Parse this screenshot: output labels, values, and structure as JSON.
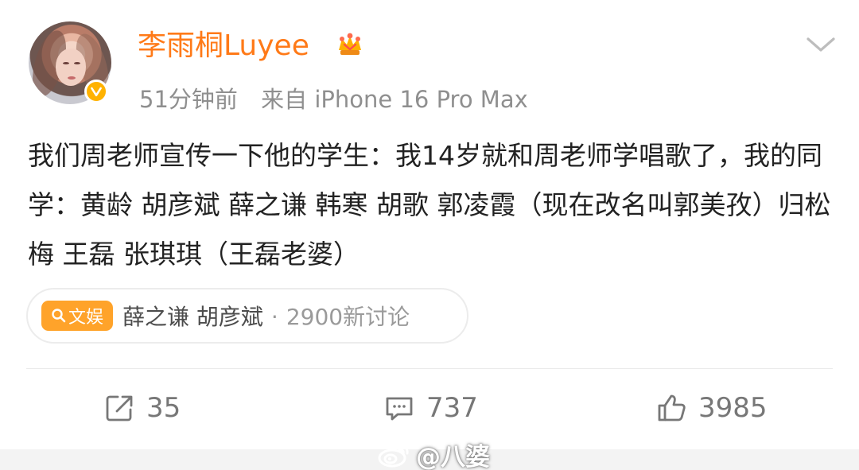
{
  "post": {
    "username": "李雨桐Luyee",
    "time": "51分钟前",
    "source": "来自 iPhone 16 Pro Max",
    "content": "我们周老师宣传一下他的学生：我14岁就和周老师学唱歌了，我的同学：黄龄 胡彦斌 薛之谦 韩寒 胡歌 郭凌霞（现在改名叫郭美孜）归松梅 王磊 张琪琪（王磊老婆）"
  },
  "topic": {
    "tag": "文娱",
    "text": "薛之谦 胡彦斌",
    "separator": "·",
    "count": "2900新讨论"
  },
  "actions": {
    "share": "35",
    "comment": "737",
    "like": "3985"
  },
  "watermark": "@八婆",
  "icons": {
    "verified": "verified-icon",
    "crown": "crown-icon",
    "chevron": "chevron-down-icon",
    "search": "search-icon",
    "share": "share-icon",
    "comment": "comment-icon",
    "like": "like-icon",
    "weibo": "weibo-icon"
  },
  "colors": {
    "username": "#ff7a18",
    "verified": "#ffb200",
    "topic_tag": "#ffa32a"
  }
}
